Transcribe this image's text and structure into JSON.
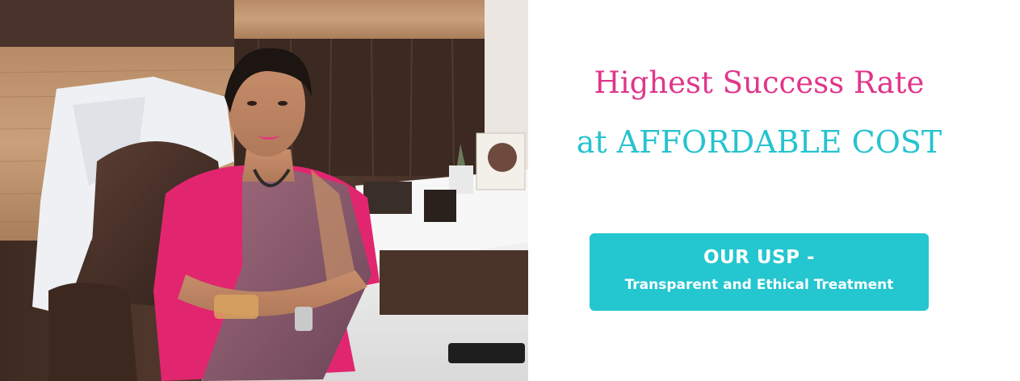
{
  "headline": {
    "line1": "Highest Success Rate",
    "line2": "at AFFORDABLE COST"
  },
  "usp": {
    "title": "OUR USP -",
    "subtitle": "Transparent and Ethical Treatment"
  },
  "colors": {
    "pink": "#e0368a",
    "teal": "#26c3cf",
    "usp_background": "#24c6cf"
  }
}
